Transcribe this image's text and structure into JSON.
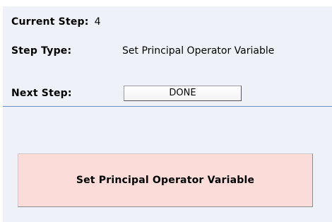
{
  "current_step": {
    "label": "Current Step:",
    "value": "4"
  },
  "step_type": {
    "label": "Step Type:",
    "value": "Set Principal Operator Variable"
  },
  "next_step": {
    "label": "Next Step:",
    "button_label": "DONE"
  },
  "step_action": {
    "label": "Set Principal Operator Variable"
  },
  "colors": {
    "panel_background": "#eef2f8",
    "divider": "#6d8fbc",
    "step_box_background": "#fcdcd8"
  }
}
